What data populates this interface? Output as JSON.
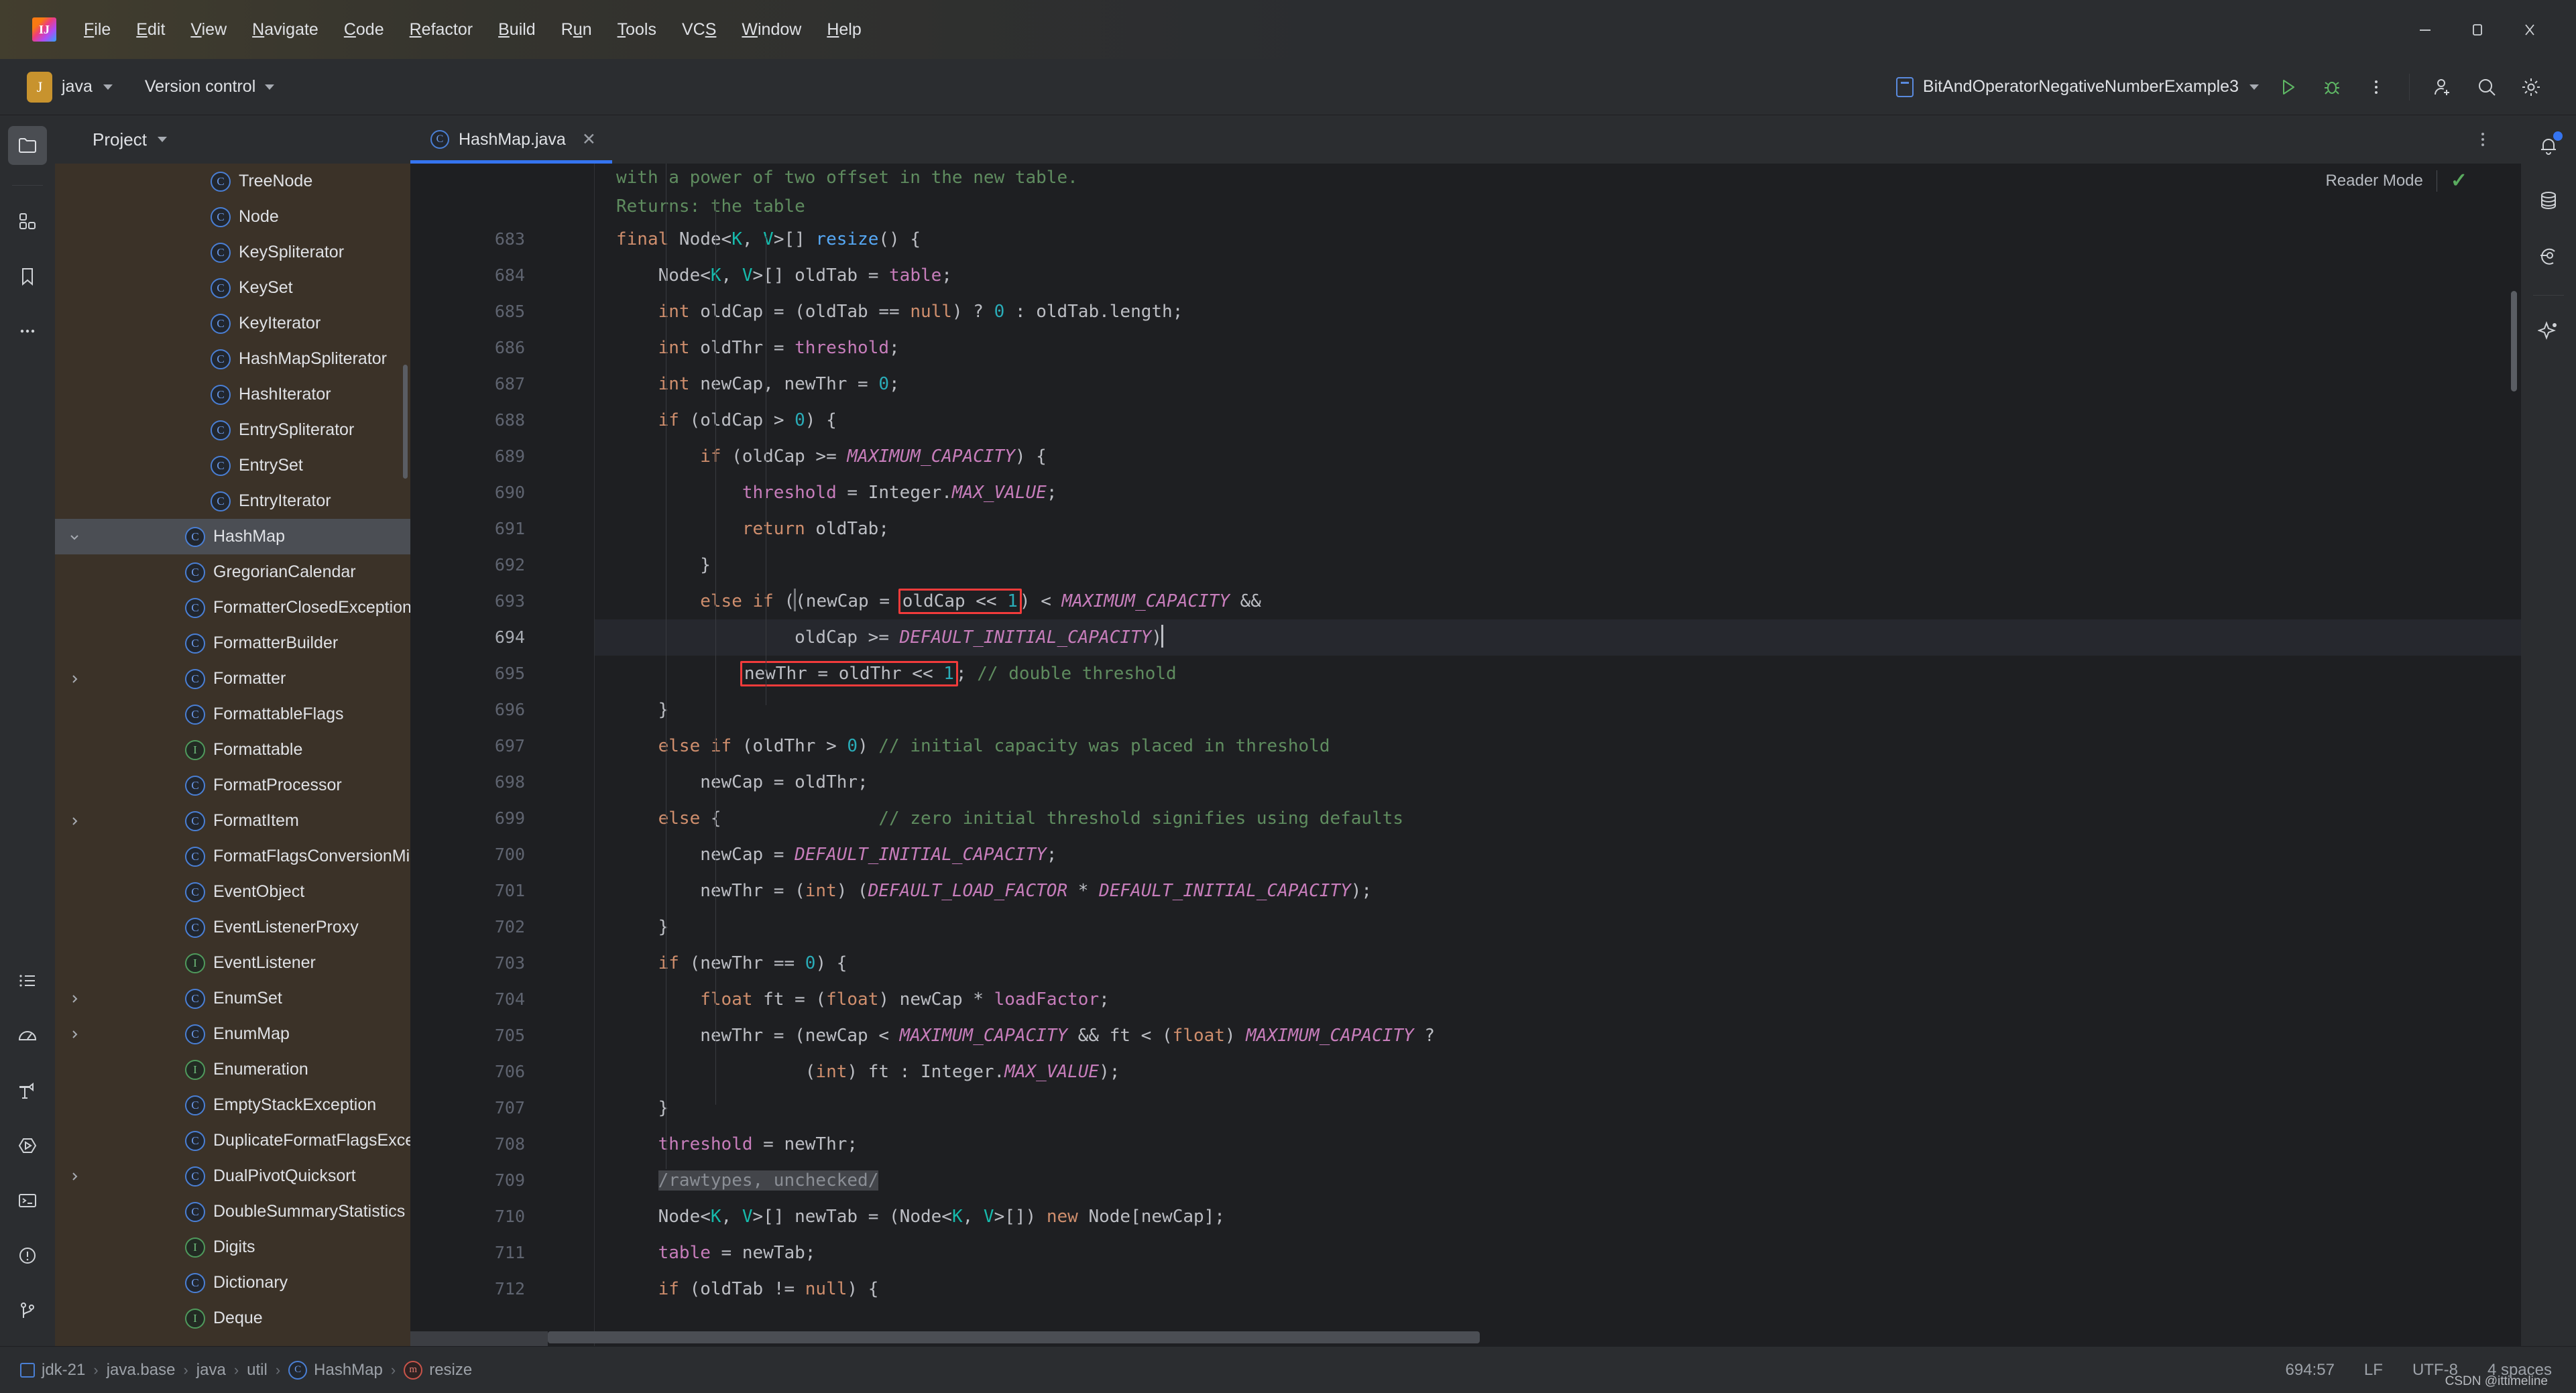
{
  "window": {
    "logo_icon": "intellij-logo-icon",
    "menu": [
      {
        "label": "File",
        "mnemonic": "F"
      },
      {
        "label": "Edit",
        "mnemonic": "E"
      },
      {
        "label": "View",
        "mnemonic": "V"
      },
      {
        "label": "Navigate",
        "mnemonic": "N"
      },
      {
        "label": "Code",
        "mnemonic": "C"
      },
      {
        "label": "Refactor",
        "mnemonic": "R"
      },
      {
        "label": "Build",
        "mnemonic": "B"
      },
      {
        "label": "Run",
        "mnemonic": "u"
      },
      {
        "label": "Tools",
        "mnemonic": "T"
      },
      {
        "label": "VCS",
        "mnemonic": "S"
      },
      {
        "label": "Window",
        "mnemonic": "W"
      },
      {
        "label": "Help",
        "mnemonic": "H"
      }
    ],
    "controls": {
      "minimize_icon": "minimize-icon",
      "maximize_icon": "maximize-icon",
      "close_icon": "close-icon"
    }
  },
  "toolbar": {
    "project_badge": "J",
    "project_name": "java",
    "version_control": "Version control",
    "run_config": "BitAndOperatorNegativeNumberExample3",
    "run_icon": "run-icon",
    "debug_icon": "debug-icon",
    "more_icon": "more-vertical-icon",
    "accent_run": "#5fb865",
    "accent_blue": "#3574f0"
  },
  "left_rail": {
    "top": [
      {
        "name": "project-icon",
        "active": true
      },
      {
        "name": "structure-icon",
        "active": false
      },
      {
        "name": "bookmarks-icon",
        "active": false
      },
      {
        "name": "more-tools-icon",
        "active": false
      }
    ],
    "bottom": [
      {
        "name": "todo-icon"
      },
      {
        "name": "profiler-icon"
      },
      {
        "name": "build-icon"
      },
      {
        "name": "run-tool-icon"
      },
      {
        "name": "terminal-icon"
      },
      {
        "name": "problems-icon"
      },
      {
        "name": "git-icon"
      }
    ]
  },
  "right_rail": [
    {
      "name": "notifications-icon",
      "badge": true
    },
    {
      "name": "database-icon",
      "badge": false
    },
    {
      "name": "commit-icon",
      "badge": false
    },
    {
      "name": "ai-assistant-icon",
      "badge": false
    }
  ],
  "project_panel": {
    "title": "Project",
    "panel_bg": "#3b3228",
    "tree": [
      {
        "label": "Deque",
        "kind": "interface",
        "indent": 3,
        "expandable": false,
        "selected": false
      },
      {
        "label": "Dictionary",
        "kind": "class",
        "indent": 3,
        "expandable": false,
        "selected": false
      },
      {
        "label": "Digits",
        "kind": "interface",
        "indent": 3,
        "expandable": false,
        "selected": false
      },
      {
        "label": "DoubleSummaryStatistics",
        "kind": "class",
        "indent": 3,
        "expandable": false,
        "selected": false
      },
      {
        "label": "DualPivotQuicksort",
        "kind": "class",
        "indent": 3,
        "expandable": true,
        "selected": false
      },
      {
        "label": "DuplicateFormatFlagsException",
        "kind": "class",
        "indent": 3,
        "expandable": false,
        "selected": false
      },
      {
        "label": "EmptyStackException",
        "kind": "class",
        "indent": 3,
        "expandable": false,
        "selected": false
      },
      {
        "label": "Enumeration",
        "kind": "interface",
        "indent": 3,
        "expandable": false,
        "selected": false
      },
      {
        "label": "EnumMap",
        "kind": "class",
        "indent": 3,
        "expandable": true,
        "selected": false
      },
      {
        "label": "EnumSet",
        "kind": "class",
        "indent": 3,
        "expandable": true,
        "selected": false
      },
      {
        "label": "EventListener",
        "kind": "interface",
        "indent": 3,
        "expandable": false,
        "selected": false
      },
      {
        "label": "EventListenerProxy",
        "kind": "class",
        "indent": 3,
        "expandable": false,
        "selected": false
      },
      {
        "label": "EventObject",
        "kind": "class",
        "indent": 3,
        "expandable": false,
        "selected": false
      },
      {
        "label": "FormatFlagsConversionMismatchException",
        "kind": "class",
        "indent": 3,
        "expandable": false,
        "selected": false
      },
      {
        "label": "FormatItem",
        "kind": "class",
        "indent": 3,
        "expandable": true,
        "selected": false
      },
      {
        "label": "FormatProcessor",
        "kind": "class",
        "indent": 3,
        "expandable": false,
        "selected": false
      },
      {
        "label": "Formattable",
        "kind": "interface",
        "indent": 3,
        "expandable": false,
        "selected": false
      },
      {
        "label": "FormattableFlags",
        "kind": "class",
        "indent": 3,
        "expandable": false,
        "selected": false
      },
      {
        "label": "Formatter",
        "kind": "class",
        "indent": 3,
        "expandable": true,
        "selected": false
      },
      {
        "label": "FormatterBuilder",
        "kind": "class",
        "indent": 3,
        "expandable": false,
        "selected": false
      },
      {
        "label": "FormatterClosedException",
        "kind": "class",
        "indent": 3,
        "expandable": false,
        "selected": false
      },
      {
        "label": "GregorianCalendar",
        "kind": "class",
        "indent": 3,
        "expandable": false,
        "selected": false
      },
      {
        "label": "HashMap",
        "kind": "class",
        "indent": 3,
        "expandable": true,
        "expanded": true,
        "selected": true
      },
      {
        "label": "EntryIterator",
        "kind": "class",
        "indent": 4,
        "expandable": false,
        "selected": false
      },
      {
        "label": "EntrySet",
        "kind": "class",
        "indent": 4,
        "expandable": false,
        "selected": false
      },
      {
        "label": "EntrySpliterator",
        "kind": "class",
        "indent": 4,
        "expandable": false,
        "selected": false
      },
      {
        "label": "HashIterator",
        "kind": "class",
        "indent": 4,
        "expandable": false,
        "selected": false
      },
      {
        "label": "HashMapSpliterator",
        "kind": "class",
        "indent": 4,
        "expandable": false,
        "selected": false
      },
      {
        "label": "KeyIterator",
        "kind": "class",
        "indent": 4,
        "expandable": false,
        "selected": false
      },
      {
        "label": "KeySet",
        "kind": "class",
        "indent": 4,
        "expandable": false,
        "selected": false
      },
      {
        "label": "KeySpliterator",
        "kind": "class",
        "indent": 4,
        "expandable": false,
        "selected": false
      },
      {
        "label": "Node",
        "kind": "class",
        "indent": 4,
        "expandable": false,
        "selected": false
      },
      {
        "label": "TreeNode",
        "kind": "class",
        "indent": 4,
        "expandable": false,
        "selected": false
      }
    ]
  },
  "editor": {
    "tab": {
      "label": "HashMap.java",
      "icon": "java-class-icon",
      "close_icon": "close-icon",
      "active": true
    },
    "tab_more_icon": "more-vertical-icon",
    "reader_mode_label": "Reader Mode",
    "inspection_status_icon": "check-icon",
    "current_line": 694,
    "first_line": 683,
    "javadoc_tail": [
      "with a power of two offset in the new table.",
      "Returns: the table"
    ],
    "lines": [
      {
        "n": 683,
        "text": "final Node<K, V>[] resize() {"
      },
      {
        "n": 684,
        "text": "    Node<K, V>[] oldTab = table;"
      },
      {
        "n": 685,
        "text": "    int oldCap = (oldTab == null) ? 0 : oldTab.length;"
      },
      {
        "n": 686,
        "text": "    int oldThr = threshold;"
      },
      {
        "n": 687,
        "text": "    int newCap, newThr = 0;"
      },
      {
        "n": 688,
        "text": "    if (oldCap > 0) {"
      },
      {
        "n": 689,
        "text": "        if (oldCap >= MAXIMUM_CAPACITY) {"
      },
      {
        "n": 690,
        "text": "            threshold = Integer.MAX_VALUE;"
      },
      {
        "n": 691,
        "text": "            return oldTab;"
      },
      {
        "n": 692,
        "text": "        }"
      },
      {
        "n": 693,
        "text": "        else if ((newCap = oldCap << 1) < MAXIMUM_CAPACITY &&"
      },
      {
        "n": 694,
        "text": "                 oldCap >= DEFAULT_INITIAL_CAPACITY)"
      },
      {
        "n": 695,
        "text": "            newThr = oldThr << 1; // double threshold"
      },
      {
        "n": 696,
        "text": "    }"
      },
      {
        "n": 697,
        "text": "    else if (oldThr > 0) // initial capacity was placed in threshold"
      },
      {
        "n": 698,
        "text": "        newCap = oldThr;"
      },
      {
        "n": 699,
        "text": "    else {               // zero initial threshold signifies using defaults"
      },
      {
        "n": 700,
        "text": "        newCap = DEFAULT_INITIAL_CAPACITY;"
      },
      {
        "n": 701,
        "text": "        newThr = (int) (DEFAULT_LOAD_FACTOR * DEFAULT_INITIAL_CAPACITY);"
      },
      {
        "n": 702,
        "text": "    }"
      },
      {
        "n": 703,
        "text": "    if (newThr == 0) {"
      },
      {
        "n": 704,
        "text": "        float ft = (float) newCap * loadFactor;"
      },
      {
        "n": 705,
        "text": "        newThr = (newCap < MAXIMUM_CAPACITY && ft < (float) MAXIMUM_CAPACITY ?"
      },
      {
        "n": 706,
        "text": "                  (int) ft : Integer.MAX_VALUE);"
      },
      {
        "n": 707,
        "text": "    }"
      },
      {
        "n": 708,
        "text": "    threshold = newThr;"
      },
      {
        "n": 709,
        "text": "    /rawtypes, unchecked/"
      },
      {
        "n": 710,
        "text": "    Node<K, V>[] newTab = (Node<K, V>[]) new Node[newCap];"
      },
      {
        "n": 711,
        "text": "    table = newTab;"
      },
      {
        "n": 712,
        "text": "    if (oldTab != null) {"
      }
    ],
    "annotations": [
      {
        "id": "box-1",
        "target_line": 693,
        "text": "oldCap << 1",
        "color": "#f23b3b"
      },
      {
        "id": "box-2",
        "target_line": 695,
        "text": "newThr = oldThr << 1",
        "color": "#f23b3b"
      }
    ],
    "syntax_colors": {
      "keyword": "#cf8e6d",
      "number": "#2aacb8",
      "field": "#c77dbb",
      "constant": "#c77dbb",
      "comment": "#5f8c5f",
      "type_param": "#16baac",
      "method": "#56a8f5",
      "text": "#bcbec4",
      "background": "#1e1f22"
    }
  },
  "status_bar": {
    "breadcrumb": [
      {
        "label": "jdk-21",
        "icon": "module-icon"
      },
      {
        "label": "java.base",
        "icon": null
      },
      {
        "label": "java",
        "icon": null
      },
      {
        "label": "util",
        "icon": null
      },
      {
        "label": "HashMap",
        "icon": "class-icon"
      },
      {
        "label": "resize",
        "icon": "method-icon"
      }
    ],
    "caret_position": "694:57",
    "line_separator": "LF",
    "encoding": "UTF-8",
    "indent": "4 spaces",
    "watermark": "CSDN @ittimeline"
  }
}
